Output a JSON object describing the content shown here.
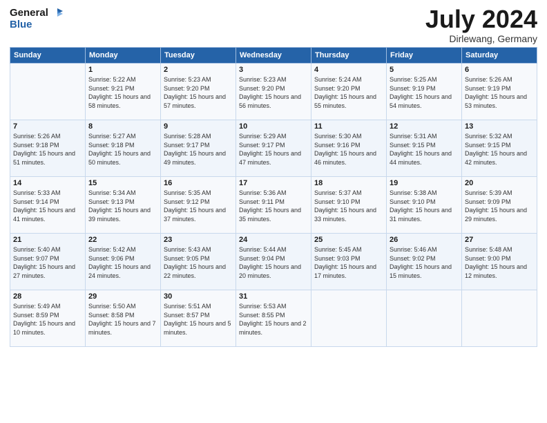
{
  "logo": {
    "line1": "General",
    "line2": "Blue"
  },
  "title": "July 2024",
  "location": "Dirlewang, Germany",
  "days_header": [
    "Sunday",
    "Monday",
    "Tuesday",
    "Wednesday",
    "Thursday",
    "Friday",
    "Saturday"
  ],
  "weeks": [
    [
      {
        "num": "",
        "sunrise": "",
        "sunset": "",
        "daylight": ""
      },
      {
        "num": "1",
        "sunrise": "Sunrise: 5:22 AM",
        "sunset": "Sunset: 9:21 PM",
        "daylight": "Daylight: 15 hours and 58 minutes."
      },
      {
        "num": "2",
        "sunrise": "Sunrise: 5:23 AM",
        "sunset": "Sunset: 9:20 PM",
        "daylight": "Daylight: 15 hours and 57 minutes."
      },
      {
        "num": "3",
        "sunrise": "Sunrise: 5:23 AM",
        "sunset": "Sunset: 9:20 PM",
        "daylight": "Daylight: 15 hours and 56 minutes."
      },
      {
        "num": "4",
        "sunrise": "Sunrise: 5:24 AM",
        "sunset": "Sunset: 9:20 PM",
        "daylight": "Daylight: 15 hours and 55 minutes."
      },
      {
        "num": "5",
        "sunrise": "Sunrise: 5:25 AM",
        "sunset": "Sunset: 9:19 PM",
        "daylight": "Daylight: 15 hours and 54 minutes."
      },
      {
        "num": "6",
        "sunrise": "Sunrise: 5:26 AM",
        "sunset": "Sunset: 9:19 PM",
        "daylight": "Daylight: 15 hours and 53 minutes."
      }
    ],
    [
      {
        "num": "7",
        "sunrise": "Sunrise: 5:26 AM",
        "sunset": "Sunset: 9:18 PM",
        "daylight": "Daylight: 15 hours and 51 minutes."
      },
      {
        "num": "8",
        "sunrise": "Sunrise: 5:27 AM",
        "sunset": "Sunset: 9:18 PM",
        "daylight": "Daylight: 15 hours and 50 minutes."
      },
      {
        "num": "9",
        "sunrise": "Sunrise: 5:28 AM",
        "sunset": "Sunset: 9:17 PM",
        "daylight": "Daylight: 15 hours and 49 minutes."
      },
      {
        "num": "10",
        "sunrise": "Sunrise: 5:29 AM",
        "sunset": "Sunset: 9:17 PM",
        "daylight": "Daylight: 15 hours and 47 minutes."
      },
      {
        "num": "11",
        "sunrise": "Sunrise: 5:30 AM",
        "sunset": "Sunset: 9:16 PM",
        "daylight": "Daylight: 15 hours and 46 minutes."
      },
      {
        "num": "12",
        "sunrise": "Sunrise: 5:31 AM",
        "sunset": "Sunset: 9:15 PM",
        "daylight": "Daylight: 15 hours and 44 minutes."
      },
      {
        "num": "13",
        "sunrise": "Sunrise: 5:32 AM",
        "sunset": "Sunset: 9:15 PM",
        "daylight": "Daylight: 15 hours and 42 minutes."
      }
    ],
    [
      {
        "num": "14",
        "sunrise": "Sunrise: 5:33 AM",
        "sunset": "Sunset: 9:14 PM",
        "daylight": "Daylight: 15 hours and 41 minutes."
      },
      {
        "num": "15",
        "sunrise": "Sunrise: 5:34 AM",
        "sunset": "Sunset: 9:13 PM",
        "daylight": "Daylight: 15 hours and 39 minutes."
      },
      {
        "num": "16",
        "sunrise": "Sunrise: 5:35 AM",
        "sunset": "Sunset: 9:12 PM",
        "daylight": "Daylight: 15 hours and 37 minutes."
      },
      {
        "num": "17",
        "sunrise": "Sunrise: 5:36 AM",
        "sunset": "Sunset: 9:11 PM",
        "daylight": "Daylight: 15 hours and 35 minutes."
      },
      {
        "num": "18",
        "sunrise": "Sunrise: 5:37 AM",
        "sunset": "Sunset: 9:10 PM",
        "daylight": "Daylight: 15 hours and 33 minutes."
      },
      {
        "num": "19",
        "sunrise": "Sunrise: 5:38 AM",
        "sunset": "Sunset: 9:10 PM",
        "daylight": "Daylight: 15 hours and 31 minutes."
      },
      {
        "num": "20",
        "sunrise": "Sunrise: 5:39 AM",
        "sunset": "Sunset: 9:09 PM",
        "daylight": "Daylight: 15 hours and 29 minutes."
      }
    ],
    [
      {
        "num": "21",
        "sunrise": "Sunrise: 5:40 AM",
        "sunset": "Sunset: 9:07 PM",
        "daylight": "Daylight: 15 hours and 27 minutes."
      },
      {
        "num": "22",
        "sunrise": "Sunrise: 5:42 AM",
        "sunset": "Sunset: 9:06 PM",
        "daylight": "Daylight: 15 hours and 24 minutes."
      },
      {
        "num": "23",
        "sunrise": "Sunrise: 5:43 AM",
        "sunset": "Sunset: 9:05 PM",
        "daylight": "Daylight: 15 hours and 22 minutes."
      },
      {
        "num": "24",
        "sunrise": "Sunrise: 5:44 AM",
        "sunset": "Sunset: 9:04 PM",
        "daylight": "Daylight: 15 hours and 20 minutes."
      },
      {
        "num": "25",
        "sunrise": "Sunrise: 5:45 AM",
        "sunset": "Sunset: 9:03 PM",
        "daylight": "Daylight: 15 hours and 17 minutes."
      },
      {
        "num": "26",
        "sunrise": "Sunrise: 5:46 AM",
        "sunset": "Sunset: 9:02 PM",
        "daylight": "Daylight: 15 hours and 15 minutes."
      },
      {
        "num": "27",
        "sunrise": "Sunrise: 5:48 AM",
        "sunset": "Sunset: 9:00 PM",
        "daylight": "Daylight: 15 hours and 12 minutes."
      }
    ],
    [
      {
        "num": "28",
        "sunrise": "Sunrise: 5:49 AM",
        "sunset": "Sunset: 8:59 PM",
        "daylight": "Daylight: 15 hours and 10 minutes."
      },
      {
        "num": "29",
        "sunrise": "Sunrise: 5:50 AM",
        "sunset": "Sunset: 8:58 PM",
        "daylight": "Daylight: 15 hours and 7 minutes."
      },
      {
        "num": "30",
        "sunrise": "Sunrise: 5:51 AM",
        "sunset": "Sunset: 8:57 PM",
        "daylight": "Daylight: 15 hours and 5 minutes."
      },
      {
        "num": "31",
        "sunrise": "Sunrise: 5:53 AM",
        "sunset": "Sunset: 8:55 PM",
        "daylight": "Daylight: 15 hours and 2 minutes."
      },
      {
        "num": "",
        "sunrise": "",
        "sunset": "",
        "daylight": ""
      },
      {
        "num": "",
        "sunrise": "",
        "sunset": "",
        "daylight": ""
      },
      {
        "num": "",
        "sunrise": "",
        "sunset": "",
        "daylight": ""
      }
    ]
  ]
}
